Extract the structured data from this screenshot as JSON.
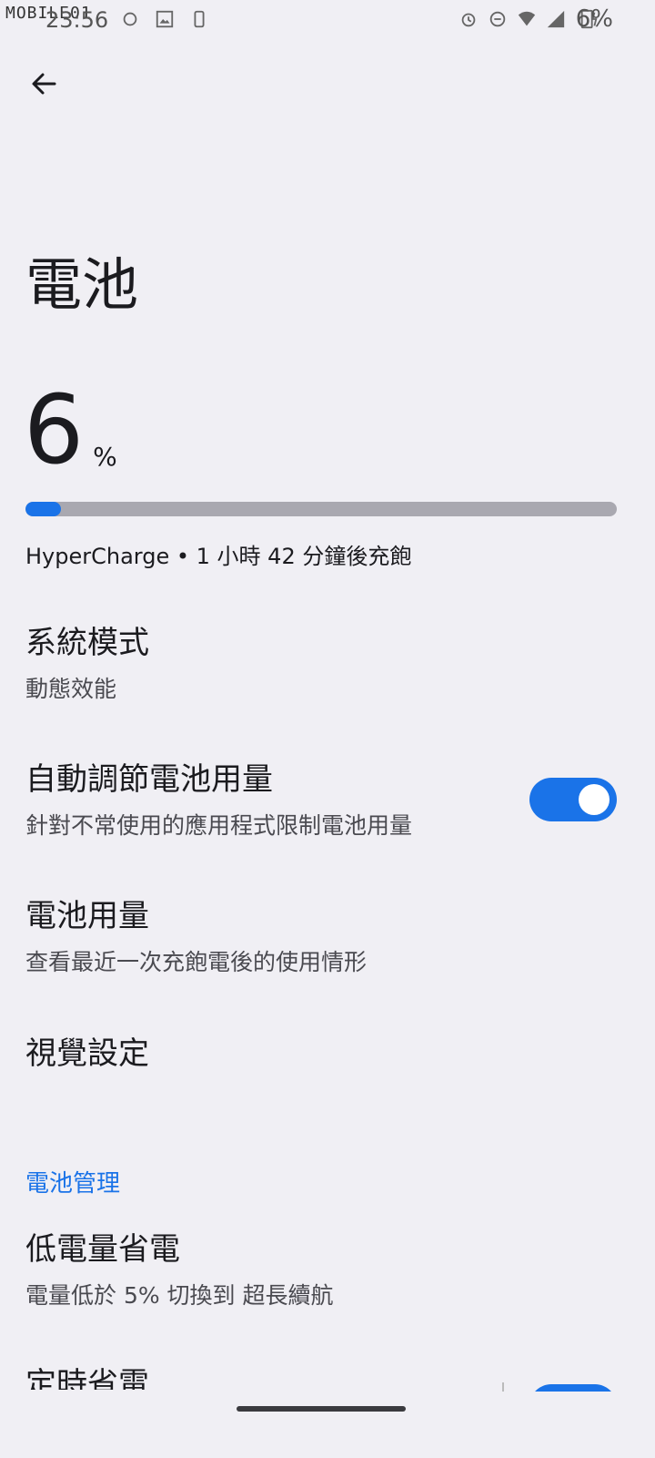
{
  "status_bar": {
    "watermark": "MOBILE01",
    "time": "23:56",
    "battery_text": "6%",
    "left_icons": [
      "sync-icon",
      "image-icon",
      "vibrate-icon"
    ],
    "right_icons": [
      "alarm-icon",
      "dnd-icon",
      "wifi-6-icon",
      "signal-icon",
      "battery-charging-icon"
    ]
  },
  "header": {
    "back_icon": "arrow-back-icon"
  },
  "page": {
    "title": "電池"
  },
  "battery": {
    "level": "6",
    "unit": "%",
    "level_fraction": 0.06,
    "status": "HyperCharge • 1 小時 42 分鐘後充飽"
  },
  "settings": {
    "system_mode": {
      "title": "系統模式",
      "subtitle": "動態效能"
    },
    "adaptive_battery": {
      "title": "自動調節電池用量",
      "subtitle": "針對不常使用的應用程式限制電池用量",
      "toggle_on": true
    },
    "battery_usage": {
      "title": "電池用量",
      "subtitle": "查看最近一次充飽電後的使用情形"
    },
    "visual_settings": {
      "title": "視覺設定"
    }
  },
  "battery_management": {
    "header": "電池管理",
    "low_power": {
      "title": "低電量省電",
      "subtitle": "電量低於 5% 切換到 超長續航"
    },
    "scheduled_saver": {
      "title": "定時省電"
    }
  },
  "colors": {
    "accent": "#1a73e8",
    "background": "#f0eff4",
    "track": "#a9a8b0"
  }
}
